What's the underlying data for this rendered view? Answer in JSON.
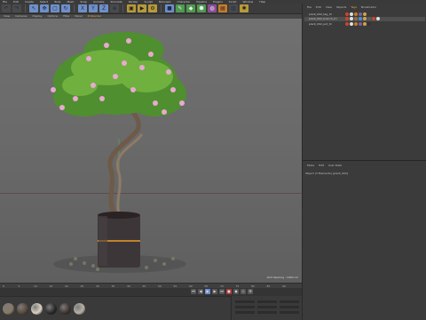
{
  "menubar": {
    "items": [
      "File",
      "Edit",
      "Create",
      "Select",
      "Tools",
      "Mesh",
      "Snap",
      "Animate",
      "Simulate",
      "Render",
      "Sculpt",
      "MoGraph",
      "Character",
      "Pipeline",
      "Plugins",
      "Script",
      "Window",
      "Help"
    ]
  },
  "toolbar": {
    "icons": [
      "undo-icon",
      "redo-icon",
      "select-icon",
      "move-icon",
      "scale-icon",
      "rotate-icon",
      "axis-x-icon",
      "axis-y-icon",
      "axis-z-icon",
      "coordinate-icon",
      "render-view-icon",
      "render-icon",
      "render-settings-icon",
      "cube-icon",
      "pen-icon",
      "subdivide-icon",
      "array-icon",
      "deformer-icon",
      "scene-icon",
      "camera-icon",
      "light-icon"
    ]
  },
  "viewport_menu": {
    "items": [
      "View",
      "Cameras",
      "Display",
      "Options",
      "Filter",
      "Panel"
    ],
    "accent_item": "ProRender"
  },
  "viewport": {
    "grid_label": "Grid Spacing : 1000 cm"
  },
  "timeline": {
    "ticks": [
      "0",
      "5",
      "10",
      "15",
      "20",
      "25",
      "30",
      "35",
      "40",
      "45",
      "50",
      "55",
      "60",
      "65",
      "70",
      "75",
      "80",
      "85",
      "90"
    ]
  },
  "materials": {
    "colors": [
      "#8a7a66",
      "#5a4b3c",
      "#d8d0c0",
      "#2a2a2a",
      "#3f3530",
      "#b6b0a6"
    ]
  },
  "object_manager": {
    "menu": [
      "File",
      "Edit",
      "View",
      "Objects",
      "Tags",
      "Bookmarks"
    ],
    "accent_item": "Tags",
    "rows": [
      {
        "name": "plant_002_tag_tri",
        "selected": false,
        "tags": [
          "#c8452d",
          "#e0e0e0",
          "#c67c2b",
          "#7a5ea0",
          "#cfa34c"
        ]
      },
      {
        "name": "plant_002_branch_tri",
        "selected": true,
        "tags": [
          "#c8452d",
          "#e0e0e0",
          "#8a6e4e",
          "#4a8fd1",
          "#cfa34c",
          "#5c5c5c",
          "#c8452d",
          "#e0e0e0"
        ]
      },
      {
        "name": "plant_002_pot_tri",
        "selected": false,
        "tags": [
          "#c8452d",
          "#e0e0e0",
          "#c67c2b",
          "#7a5ea0",
          "#cfa34c",
          "#333333"
        ]
      }
    ]
  },
  "attributes": {
    "menu": [
      "Mode",
      "Edit",
      "User Data"
    ],
    "mode_line": "Object (3 Elements) [plant_002]"
  },
  "accent_color": "#e0a838"
}
